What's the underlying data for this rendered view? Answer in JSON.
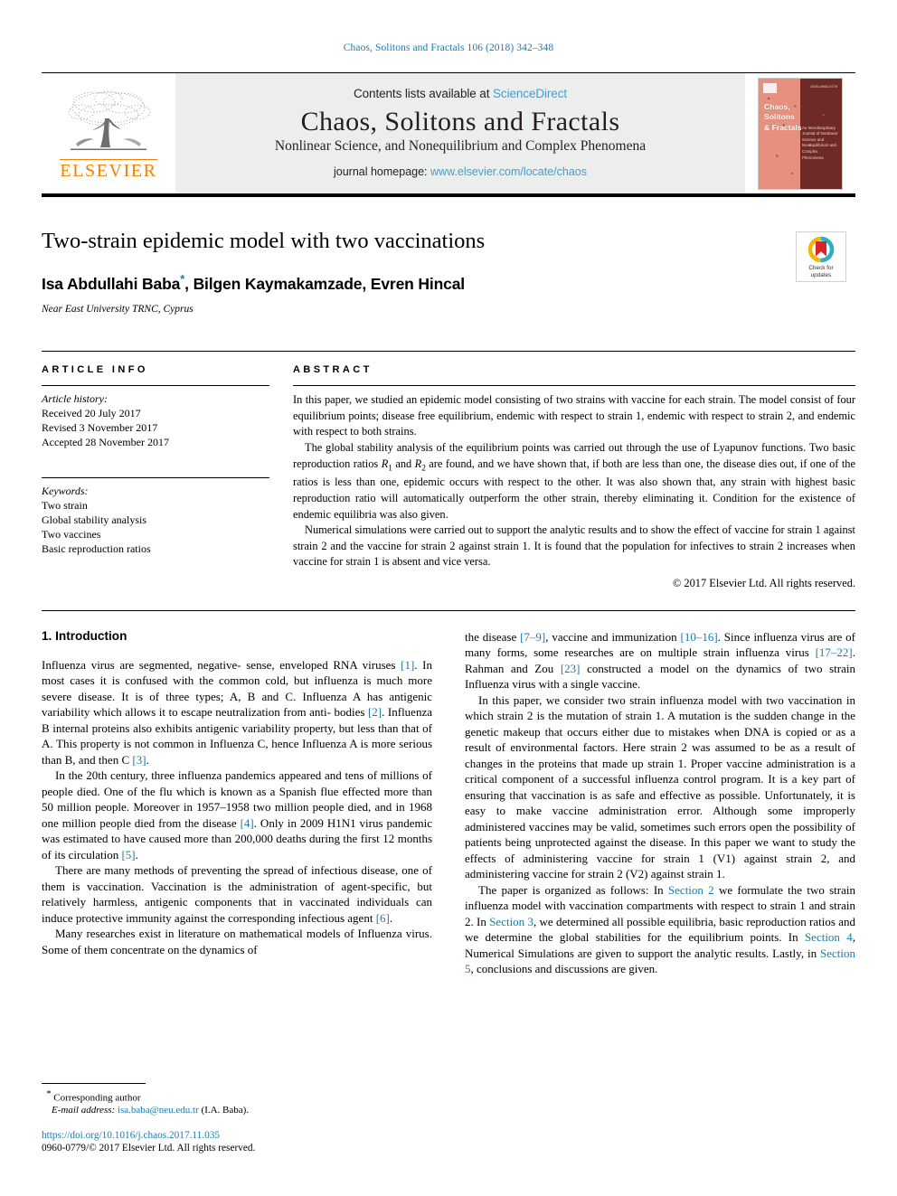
{
  "running_head": "Chaos, Solitons and Fractals 106 (2018) 342–348",
  "masthead": {
    "contents_prefix": "Contents lists available at ",
    "sciencedirect": "ScienceDirect",
    "journal_title": "Chaos, Solitons and Fractals",
    "journal_subtitle": "Nonlinear Science, and Nonequilibrium and Complex Phenomena",
    "homepage_label": "journal homepage: ",
    "homepage_url": "www.elsevier.com/locate/chaos",
    "publisher": "ELSEVIER",
    "publisher_color": "#ef8200",
    "link_color": "#3f9fd4",
    "cover": {
      "title_line1": "Chaos,",
      "title_line2": "Solitons",
      "title_line3": "& Fractals",
      "blurb": "An Interdisciplinary Journal of Nonlinear Science and Nonequilibrium and Complex Phenomena",
      "top_right": "ISSN 0960-0779"
    }
  },
  "article": {
    "title": "Two-strain epidemic model with two vaccinations",
    "authors": "Isa Abdullahi Baba",
    "authors_rest": ", Bilgen Kaymakamzade, Evren Hincal",
    "corresponding_marker": "*",
    "affiliation": "Near East University TRNC, Cyprus",
    "crossmark": {
      "line1": "Check for",
      "line2": "updates"
    }
  },
  "article_info": {
    "heading": "ARTICLE INFO",
    "history_label": "Article history:",
    "history": [
      "Received 20 July 2017",
      "Revised 3 November 2017",
      "Accepted 28 November 2017"
    ],
    "keywords_label": "Keywords:",
    "keywords": [
      "Two strain",
      "Global stability analysis",
      "Two vaccines",
      "Basic reproduction ratios"
    ]
  },
  "abstract": {
    "heading": "ABSTRACT",
    "p1": "In this paper, we studied an epidemic model consisting of two strains with vaccine for each strain. The model consist of four equilibrium points; disease free equilibrium, endemic with respect to strain 1, endemic with respect to strain 2, and endemic with respect to both strains.",
    "p2_a": "The global stability analysis of the equilibrium points was carried out through the use of Lyapunov functions. Two basic reproduction ratios ",
    "p2_r1": "R",
    "p2_r1_sub": "1",
    "p2_b": " and ",
    "p2_r2": "R",
    "p2_r2_sub": "2",
    "p2_c": " are found, and we have shown that, if both are less than one, the disease dies out, if one of the ratios is less than one, epidemic occurs with respect to the other. It was also shown that, any strain with highest basic reproduction ratio will automatically outperform the other strain, thereby eliminating it. Condition for the existence of endemic equilibria was also given.",
    "p3": "Numerical simulations were carried out to support the analytic results and to show the effect of vaccine for strain 1 against strain 2 and the vaccine for strain 2 against strain 1. It is found that the population for infectives to strain 2 increases when vaccine for strain 1 is absent and vice versa.",
    "copyright": "© 2017 Elsevier Ltd. All rights reserved."
  },
  "introduction": {
    "heading": "1. Introduction",
    "left": {
      "p1_a": "Influenza virus are segmented, negative- sense, enveloped RNA viruses ",
      "p1_ref1": "[1]",
      "p1_b": ". In most cases it is confused with the common cold, but influenza is much more severe disease. It is of three types; A, B and C. Influenza A has antigenic variability which allows it to escape neutralization from anti- bodies ",
      "p1_ref2": "[2]",
      "p1_c": ". Influenza B internal proteins also exhibits antigenic variability property, but less than that of A. This property is not common in Influenza C, hence Influenza A is more serious than B, and then C ",
      "p1_ref3": "[3]",
      "p1_d": ".",
      "p2_a": "In the 20th century, three influenza pandemics appeared and tens of millions of people died. One of the flu which is known as a Spanish flue effected more than 50 million people. Moreover in 1957–1958 two million people died, and in 1968 one million people died from the disease ",
      "p2_ref4": "[4]",
      "p2_b": ". Only in 2009 H1N1 virus pandemic was estimated to have caused more than 200,000 deaths during the first 12 months of its circulation ",
      "p2_ref5": "[5]",
      "p2_c": ".",
      "p3_a": "There are many methods of preventing the spread of infectious disease, one of them is vaccination. Vaccination is the administration of agent-specific, but relatively harmless, antigenic components that in vaccinated individuals can induce protective immunity against the corresponding infectious agent ",
      "p3_ref6": "[6]",
      "p3_b": ".",
      "p4": "Many researches exist in literature on mathematical models of Influenza virus. Some of them concentrate on the dynamics of"
    },
    "right": {
      "p1_a": "the disease ",
      "p1_ref79": "[7–9]",
      "p1_b": ", vaccine and immunization ",
      "p1_ref1016": "[10–16]",
      "p1_c": ". Since influenza virus are of many forms, some researches are on multiple strain influenza virus ",
      "p1_ref1722": "[17–22]",
      "p1_d": ". Rahman and Zou ",
      "p1_ref23": "[23]",
      "p1_e": " constructed a model on the dynamics of two strain Influenza virus with a single vaccine.",
      "p2": "In this paper, we consider two strain influenza model with two vaccination in which strain 2 is the mutation of strain 1. A mutation is the sudden change in the genetic makeup that occurs either due to mistakes when DNA is copied or as a result of environmental factors. Here strain 2 was assumed to be as a result of changes in the proteins that made up strain 1. Proper vaccine administration is a critical component of a successful influenza control program. It is a key part of ensuring that vaccination is as safe and effective as possible. Unfortunately, it is easy to make vaccine administration error. Although some improperly administered vaccines may be valid, sometimes such errors open the possibility of patients being unprotected against the disease. In this paper we want to study the effects of administering vaccine for strain 1 (V1) against strain 2, and administering vaccine for strain 2 (V2) against strain 1.",
      "p3_a": "The paper is organized as follows: In ",
      "p3_sec2": "Section 2",
      "p3_b": " we formulate the two strain influenza model with vaccination compartments with respect to strain 1 and strain 2. In ",
      "p3_sec3": "Section 3",
      "p3_c": ", we determined all possible equilibria, basic reproduction ratios and we determine the global stabilities for the equilibrium points. In ",
      "p3_sec4": "Section 4",
      "p3_d": ", Numerical Simulations are given to support the analytic results. Lastly, in ",
      "p3_sec5": "Section 5",
      "p3_e": ", conclusions and discussions are given."
    }
  },
  "footer": {
    "corresponding_marker": "*",
    "corresponding_label": "Corresponding author",
    "email_label": "E-mail address:",
    "email": "isa.baba@neu.edu.tr",
    "email_owner": "(I.A. Baba).",
    "doi": "https://doi.org/10.1016/j.chaos.2017.11.035",
    "issn": "0960-0779/© 2017 Elsevier Ltd. All rights reserved."
  }
}
